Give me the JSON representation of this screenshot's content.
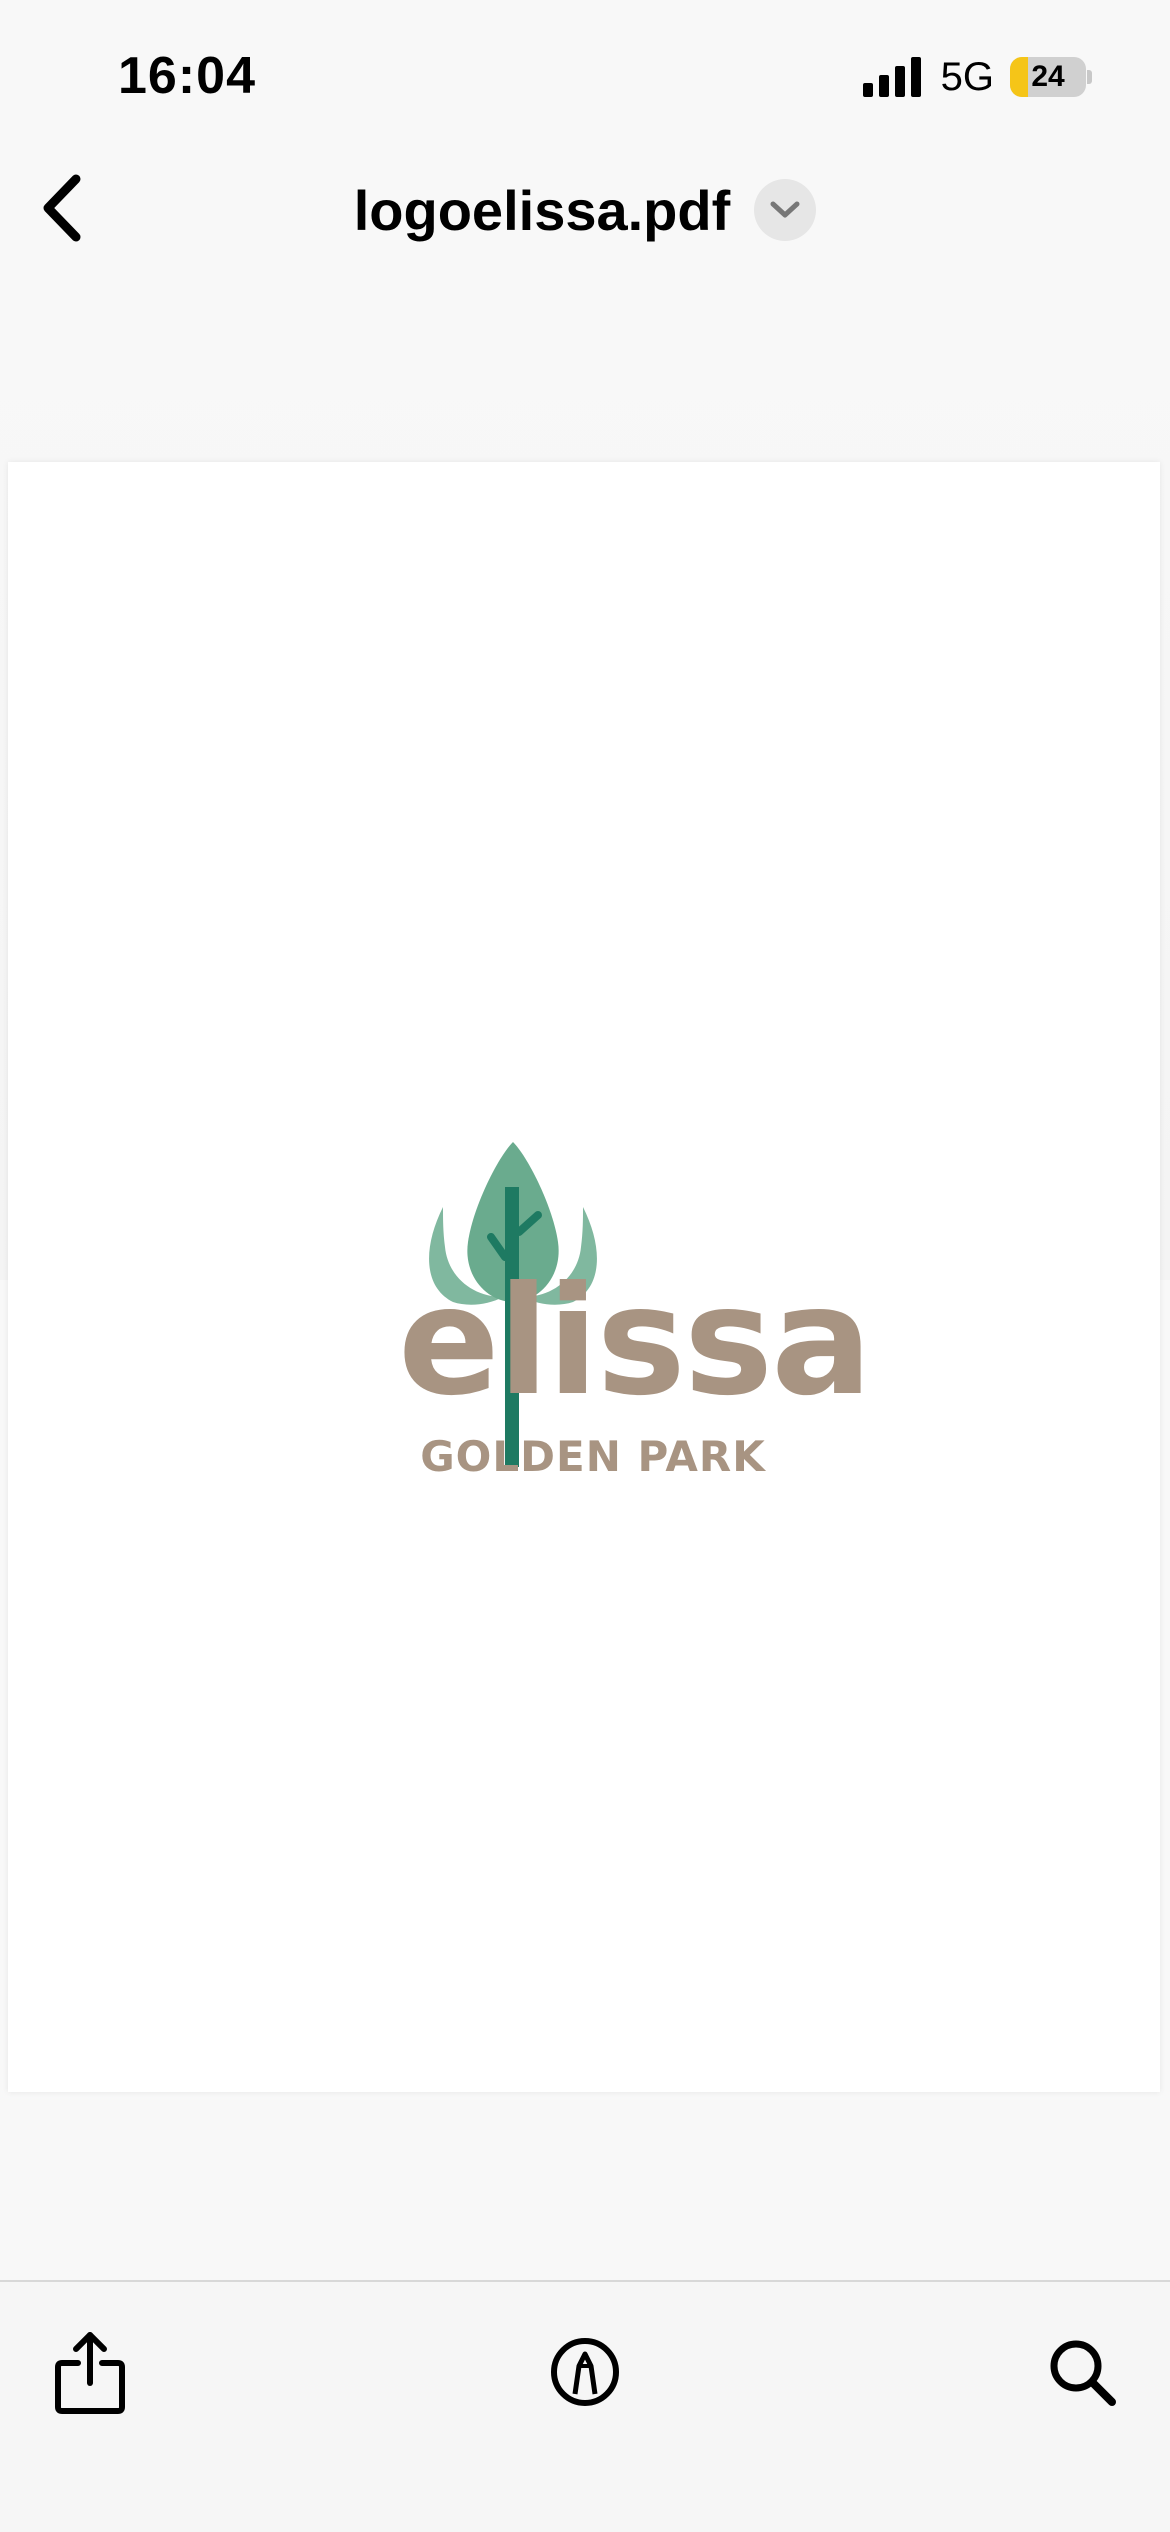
{
  "status_bar": {
    "time": "16:04",
    "network": "5G",
    "battery_level": "24",
    "battery_fraction": 0.24,
    "icons": [
      "signal-bars-icon",
      "battery-icon"
    ]
  },
  "nav": {
    "title": "logoelissa.pdf",
    "icons": [
      "chevron-left-icon",
      "chevron-down-icon"
    ]
  },
  "document": {
    "logo": {
      "wordmark": "elissa",
      "tagline": "GOLDEN PARK",
      "colors": {
        "leaf": "#6aab8e",
        "trunk": "#1e7a62",
        "text": "#a89482"
      }
    }
  },
  "toolbar": {
    "icons": [
      "share-icon",
      "markup-pen-icon",
      "search-icon"
    ]
  },
  "colors": {
    "background": "#f8f8f8",
    "page": "#ffffff",
    "battery_fill": "#f5c518",
    "menu_button": "#e6e6e6"
  }
}
